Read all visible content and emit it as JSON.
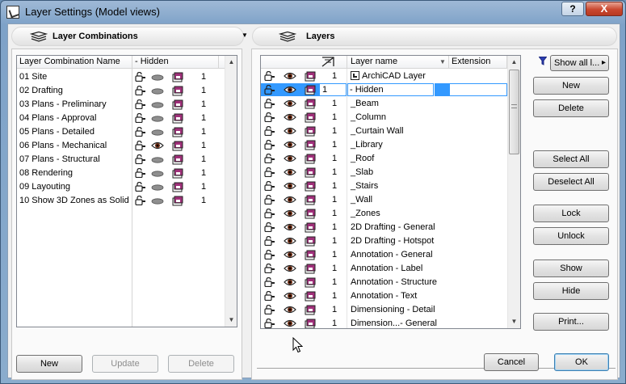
{
  "window": {
    "title": "Layer Settings (Model views)",
    "help_label": "?",
    "close_label": "X"
  },
  "left": {
    "header": "Layer Combinations",
    "columns": {
      "name": "Layer Combination Name",
      "hidden": "- Hidden"
    },
    "rows": [
      {
        "name": "01 Site",
        "num": "1",
        "vis": "hide"
      },
      {
        "name": "02 Drafting",
        "num": "1",
        "vis": "hide"
      },
      {
        "name": "03 Plans - Preliminary",
        "num": "1",
        "vis": "hide"
      },
      {
        "name": "04 Plans - Approval",
        "num": "1",
        "vis": "hide"
      },
      {
        "name": "05 Plans - Detailed",
        "num": "1",
        "vis": "hide"
      },
      {
        "name": "06 Plans - Mechanical",
        "num": "1",
        "vis": "show"
      },
      {
        "name": "07 Plans - Structural",
        "num": "1",
        "vis": "hide"
      },
      {
        "name": "08 Rendering",
        "num": "1",
        "vis": "hide"
      },
      {
        "name": "09 Layouting",
        "num": "1",
        "vis": "hide"
      },
      {
        "name": "10 Show 3D Zones as Solid",
        "num": "1",
        "vis": "hide"
      }
    ],
    "buttons": {
      "new": "New",
      "update": "Update",
      "delete": "Delete"
    }
  },
  "right": {
    "header": "Layers",
    "columns": {
      "name": "Layer name",
      "extension": "Extension"
    },
    "filter": {
      "label": "Show all l...",
      "arrow": "▸"
    },
    "edit_row": {
      "num": "1",
      "name": "- Hidden"
    },
    "rows": [
      {
        "name": "ArchiCAD Layer",
        "num": "1",
        "special": true
      },
      {
        "name": "- Hidden",
        "num": "1",
        "editing": true
      },
      {
        "name": "_Beam",
        "num": "1"
      },
      {
        "name": "_Column",
        "num": "1"
      },
      {
        "name": "_Curtain Wall",
        "num": "1"
      },
      {
        "name": "_Library",
        "num": "1"
      },
      {
        "name": "_Roof",
        "num": "1"
      },
      {
        "name": "_Slab",
        "num": "1"
      },
      {
        "name": "_Stairs",
        "num": "1"
      },
      {
        "name": "_Wall",
        "num": "1"
      },
      {
        "name": "_Zones",
        "num": "1"
      },
      {
        "name": "2D Drafting - General",
        "num": "1"
      },
      {
        "name": "2D Drafting - Hotspot",
        "num": "1"
      },
      {
        "name": "Annotation - General",
        "num": "1"
      },
      {
        "name": "Annotation - Label",
        "num": "1"
      },
      {
        "name": "Annotation - Structure",
        "num": "1"
      },
      {
        "name": "Annotation - Text",
        "num": "1"
      },
      {
        "name": "Dimensioning - Detail",
        "num": "1"
      },
      {
        "name": "Dimension...- General",
        "num": "1"
      }
    ],
    "buttons": {
      "new": "New",
      "delete": "Delete",
      "select_all": "Select All",
      "deselect_all": "Deselect All",
      "lock": "Lock",
      "unlock": "Unlock",
      "show": "Show",
      "hide": "Hide",
      "print": "Print..."
    }
  },
  "footer": {
    "cancel": "Cancel",
    "ok": "OK"
  },
  "colors": {
    "accent": "#3399ff",
    "layer_icon": "#a0307a"
  }
}
